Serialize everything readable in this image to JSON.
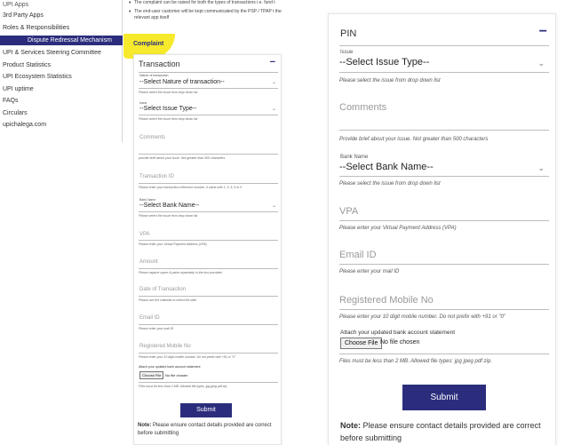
{
  "sidebar": {
    "items": [
      "3rd Party Apps",
      "Roles & Responsibilities",
      "Dispute Redressal Mechanism",
      "UPI & Services Steering Committee",
      "Product Statistics",
      "UPI Ecosystem Statistics",
      "UPI uptime",
      "FAQs",
      "Circulars",
      "upichalega.com"
    ],
    "active_index": 2,
    "cut_item": "UPI Apps"
  },
  "notice": {
    "items": [
      "The complaint can be raised for both the types of transactions i.e. fund t",
      "The end-user customer will be kept communicated by the PSP / TPAP t the relevant app itself"
    ]
  },
  "complaint_heading": "Complaint",
  "small_form": {
    "title": "Transaction",
    "toggle": "−",
    "nature_label": "Nature of transaction",
    "nature_value": "--Select Nature of transaction--",
    "nature_help": "Please select the issue from drop down list",
    "issue_label": "Issue",
    "issue_value": "--Select Issue Type--",
    "issue_help": "Please select the issue from drop down list",
    "comments_ph": "Comments",
    "comments_help": "provide brief about your issue. Not greater than 500 characters",
    "txn_id_ph": "Transaction ID",
    "txn_id_help": "Please enter your transaction reference number. It starts with 1, 5, 8, 9 or 0",
    "bank_label": "Bank Name",
    "bank_value": "--Select Bank Name--",
    "bank_help": "Please select the issue from drop down list",
    "vpa_ph": "VPA",
    "vpa_help": "Please enter your Virtual Payment Address (VPA)",
    "amount_ph": "Amount",
    "amount_help": "Please capture rupee & paise separately in the box provided",
    "date_ph": "Date of Transaction",
    "date_help": "Please use the calendar to select the date",
    "email_ph": "Email ID",
    "email_help": "Please enter your mail ID",
    "mobile_ph": "Registered Mobile No",
    "mobile_help": "Please enter your 10 digit mobile number. Do not prefix with +91 or \"0\"",
    "attach_label": "Attach your updated bank account statement",
    "file_button": "Choose File",
    "file_status": "No file chosen",
    "file_help": "Files must be less than 2 MB. Allowed file types: jpg jpeg pdf zip.",
    "submit": "Submit"
  },
  "small_note": {
    "bold": "Note:",
    "text": " Please ensure contact details provided are correct before submitting"
  },
  "right_form": {
    "title": "PIN",
    "toggle": "−",
    "issue_label": "Issue",
    "issue_value": "--Select Issue Type--",
    "issue_help": "Please select the issue from drop down list",
    "comments_ph": "Comments",
    "comments_help": "Provide brief about your issue. Not greater than 500 characters",
    "bank_label": "Bank Name",
    "bank_value": "--Select Bank Name--",
    "bank_help": "Please select the issue from drop down list",
    "vpa_ph": "VPA",
    "vpa_help": "Please enter your Virtual Payment Address (VPA)",
    "email_ph": "Email ID",
    "email_help": "Please enter your mail ID",
    "mobile_ph": "Registered Mobile No",
    "mobile_help": "Please enter your 10 digit mobile number. Do not prefix with +91 or \"0\"",
    "attach_label": "Attach your updated bank account statement",
    "file_button": "Choose File",
    "file_status": "No file chosen",
    "file_help": "Files must be less than 2 MB. Allowed file types: jpg jpeg pdf zip.",
    "submit": "Submit"
  },
  "right_note": {
    "bold": "Note:",
    "text": " Please ensure contact details provided are correct before submitting"
  },
  "colors": {
    "brand_navy": "#2b2d7c",
    "highlight_yellow": "#f7ea2d"
  },
  "icons": {
    "toggle": "minus-icon",
    "dropdown": "chevron-down-icon"
  }
}
